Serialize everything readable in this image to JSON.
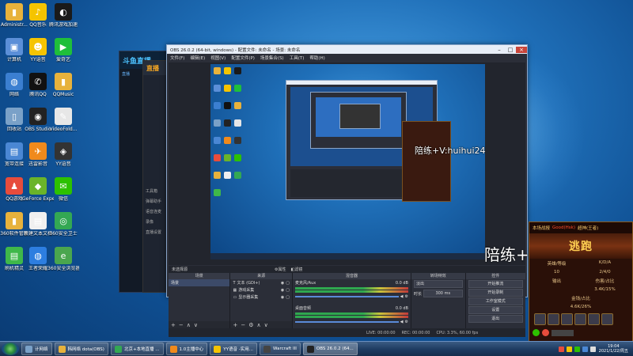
{
  "desktop": {
    "icons": [
      {
        "label": "Administr...",
        "color": "#e7b23c",
        "glyph": "▮"
      },
      {
        "label": "QQ音乐",
        "color": "#f5c400",
        "glyph": "♪"
      },
      {
        "label": "腾讯游戏加速",
        "color": "#1a1a1a",
        "glyph": "◐"
      },
      {
        "label": "计算机",
        "color": "#5b8fd8",
        "glyph": "▣"
      },
      {
        "label": "YY语音",
        "color": "#f5c400",
        "glyph": "☻"
      },
      {
        "label": "爱奇艺",
        "color": "#1fbf3a",
        "glyph": "▶"
      },
      {
        "label": "网络",
        "color": "#3b7fd1",
        "glyph": "◍"
      },
      {
        "label": "腾讯QQ",
        "color": "#111",
        "glyph": "✆"
      },
      {
        "label": "QQMusic",
        "color": "#e7b23c",
        "glyph": "▮"
      },
      {
        "label": "回收站",
        "color": "#7aa1c8",
        "glyph": "▯"
      },
      {
        "label": "OBS Studio",
        "color": "#222",
        "glyph": "◉"
      },
      {
        "label": "VideoFold...",
        "color": "#e7e7e7",
        "glyph": "✎"
      },
      {
        "label": "宽带连接",
        "color": "#4a87d4",
        "glyph": "▤"
      },
      {
        "label": "迅雷影音",
        "color": "#f08a1c",
        "glyph": "✈"
      },
      {
        "label": "YY语音",
        "color": "#333",
        "glyph": "◈"
      },
      {
        "label": "QQ游戏",
        "color": "#e74c3c",
        "glyph": "♟"
      },
      {
        "label": "GeForce Experience",
        "color": "#6ab42a",
        "glyph": "◆"
      },
      {
        "label": "微信",
        "color": "#2dc100",
        "glyph": "✉"
      },
      {
        "label": "360软件管家",
        "color": "#e7b23c",
        "glyph": "▮"
      },
      {
        "label": "新建文本文档",
        "color": "#f0f0f0",
        "glyph": "▤"
      },
      {
        "label": "360安全卫士",
        "color": "#33a853",
        "glyph": "◎"
      },
      {
        "label": "刷机精灵",
        "color": "#3fb84a",
        "glyph": "▤"
      },
      {
        "label": "王者荣耀",
        "color": "#2d7ee0",
        "glyph": "◍"
      },
      {
        "label": "360安全浏览器",
        "color": "#4aa64e",
        "glyph": "e"
      }
    ]
  },
  "bg_window_a": {
    "logo": "斗鱼直播",
    "tab": "直播"
  },
  "bg_window_b": {
    "logo": "直播",
    "items": [
      "工具箱",
      "弹幕助手",
      "语音连麦",
      "录像",
      "直播设置"
    ]
  },
  "obs": {
    "title": "OBS 26.0.2 (64-bit, windows) - 配置文件: 未命名 - 场景: 未命名",
    "menu": [
      "文件(F)",
      "编辑(E)",
      "视图(V)",
      "配置文件(P)",
      "场景集合(S)",
      "工具(T)",
      "帮助(H)"
    ],
    "no_source_selected": "未选择源",
    "properties_btn": "属性",
    "filters_btn": "滤镜",
    "docks": {
      "scenes": {
        "header": "场景",
        "items": [
          "场景"
        ]
      },
      "sources": {
        "header": "来源",
        "items": [
          "文本 (GDI+)",
          "游戏采集",
          "显示器采集"
        ]
      },
      "mixer": {
        "header": "混音器",
        "channels": [
          {
            "name": "麦克风/Aux",
            "db": "0.0 dB"
          },
          {
            "name": "桌面音频",
            "db": "0.0 dB"
          }
        ]
      },
      "transitions": {
        "header": "转场特效",
        "type": "淡出",
        "duration_label": "时长",
        "duration": "300 ms"
      },
      "controls": {
        "header": "控件",
        "buttons": [
          "开始推流",
          "开始录制",
          "工作室模式",
          "设置",
          "退出"
        ]
      }
    },
    "status": {
      "live": "LIVE: 00:00:00",
      "rec": "REC: 00:00:00",
      "cpu": "CPU: 3.3%, 60.00 fps"
    }
  },
  "watermark": {
    "text": "陪练+V:huihui249"
  },
  "game_panel": {
    "header_prefix": "本场战报",
    "header_red": "Good(Hsk)",
    "header_suffix": "超神(王者)",
    "banner": "逃跑",
    "cols1": [
      "英雄/等级",
      "K/D/A"
    ],
    "vals1": [
      "10",
      "2/4/0"
    ],
    "cols2": [
      "输出",
      "伤害/占比"
    ],
    "vals2": [
      "",
      "3.4K/15%"
    ],
    "cols3": [
      "金钱/占比"
    ],
    "vals3": [
      "4.6K/26%"
    ]
  },
  "taskbar": {
    "items": [
      {
        "label": "计网络",
        "color": "#7aa1c8"
      },
      {
        "label": "韩网络 dota(OBS)",
        "color": "#e7b23c"
      },
      {
        "label": "北京+本地直播 ...",
        "color": "#33a853"
      },
      {
        "label": "1.0主播中心",
        "color": "#f08a1c"
      },
      {
        "label": "YY语音 -实用...",
        "color": "#f5c400"
      },
      {
        "label": "Warcraft III",
        "color": "#444"
      },
      {
        "label": "OBS 26.0.2 (64...",
        "color": "#222"
      }
    ],
    "time": "19:04",
    "date": "2021/1/22/周五"
  }
}
